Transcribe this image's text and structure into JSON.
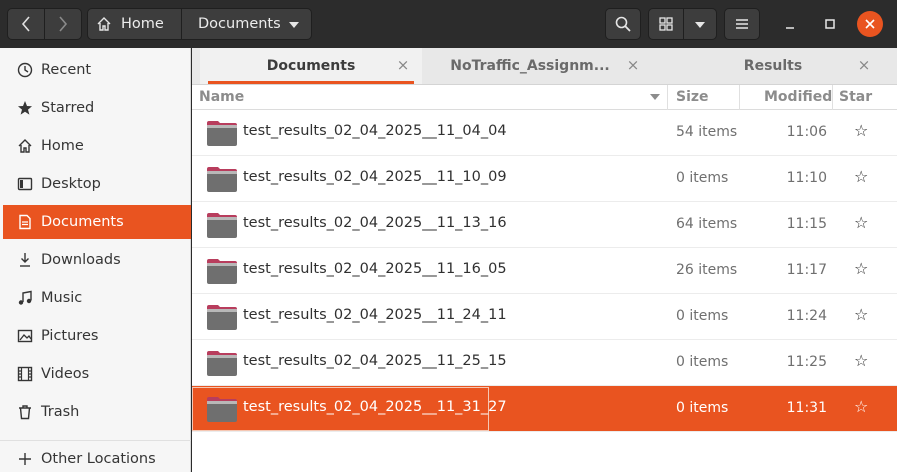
{
  "header": {
    "path_home": "Home",
    "path_current": "Documents"
  },
  "window_controls": {
    "minimize": "–",
    "maximize": "□",
    "close": "×"
  },
  "sidebar": {
    "items": [
      {
        "label": "Recent",
        "icon": "clock-icon"
      },
      {
        "label": "Starred",
        "icon": "star-icon"
      },
      {
        "label": "Home",
        "icon": "home-icon"
      },
      {
        "label": "Desktop",
        "icon": "desktop-icon"
      },
      {
        "label": "Documents",
        "icon": "document-icon",
        "active": true
      },
      {
        "label": "Downloads",
        "icon": "download-icon"
      },
      {
        "label": "Music",
        "icon": "music-icon"
      },
      {
        "label": "Pictures",
        "icon": "pictures-icon"
      },
      {
        "label": "Videos",
        "icon": "video-icon"
      },
      {
        "label": "Trash",
        "icon": "trash-icon"
      },
      {
        "label": "Other Locations",
        "icon": "plus-icon"
      }
    ]
  },
  "tabs": [
    {
      "label": "Documents",
      "active": true
    },
    {
      "label": "NoTraffic_Assignm..."
    },
    {
      "label": "Results"
    }
  ],
  "columns": {
    "name": "Name",
    "size": "Size",
    "modified": "Modified",
    "star": "Star"
  },
  "files": [
    {
      "name": "test_results_02_04_2025__11_04_04",
      "size": "54 items",
      "modified": "11:06"
    },
    {
      "name": "test_results_02_04_2025__11_10_09",
      "size": "0 items",
      "modified": "11:10"
    },
    {
      "name": "test_results_02_04_2025__11_13_16",
      "size": "64 items",
      "modified": "11:15"
    },
    {
      "name": "test_results_02_04_2025__11_16_05",
      "size": "26 items",
      "modified": "11:17"
    },
    {
      "name": "test_results_02_04_2025__11_24_11",
      "size": "0 items",
      "modified": "11:24"
    },
    {
      "name": "test_results_02_04_2025__11_25_15",
      "size": "0 items",
      "modified": "11:25"
    },
    {
      "name": "test_results_02_04_2025__11_31_27",
      "size": "0 items",
      "modified": "11:31",
      "selected": true
    }
  ],
  "star_glyph": "☆",
  "colors": {
    "accent": "#e95420",
    "headerbar": "#2c2c2c",
    "sidebar": "#f6f6f6"
  }
}
